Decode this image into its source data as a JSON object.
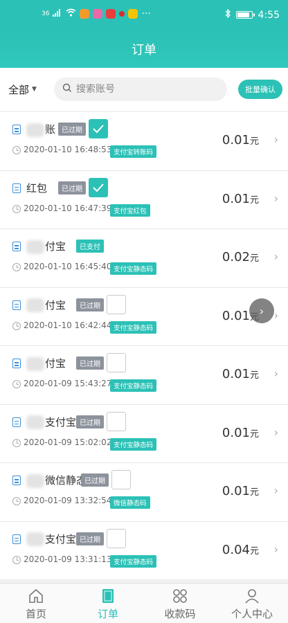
{
  "statusbar": {
    "signal": "36",
    "time": "4:55",
    "dots": "···"
  },
  "header": {
    "title": "订单"
  },
  "toolbar": {
    "filter": "全部",
    "search_placeholder": "搜索账号",
    "batch_confirm": "批量确认"
  },
  "orders": [
    {
      "name": "账",
      "status": "已过期",
      "status_type": "expired",
      "checked": true,
      "time": "2020-01-10 16:48:53",
      "channel": "支付宝转账码",
      "amount": "0.01",
      "unit": "元"
    },
    {
      "name": "红包",
      "status": "已过期",
      "status_type": "expired",
      "checked": true,
      "time": "2020-01-10 16:47:39",
      "channel": "支付宝红包",
      "amount": "0.01",
      "unit": "元"
    },
    {
      "name": "付宝",
      "status": "已支付",
      "status_type": "paid",
      "checked": null,
      "time": "2020-01-10 16:45:40",
      "channel": "支付宝静态码",
      "amount": "0.02",
      "unit": "元"
    },
    {
      "name": "付宝",
      "status": "已过期",
      "status_type": "expired",
      "checked": false,
      "time": "2020-01-10 16:42:44",
      "channel": "支付宝静态码",
      "amount": "0.01",
      "unit": "元"
    },
    {
      "name": "付宝",
      "status": "已过期",
      "status_type": "expired",
      "checked": false,
      "time": "2020-01-09 15:43:27",
      "channel": "支付宝静态码",
      "amount": "0.01",
      "unit": "元"
    },
    {
      "name": "支付宝",
      "status": "已过期",
      "status_type": "expired",
      "checked": false,
      "time": "2020-01-09 15:02:02",
      "channel": "支付宝静态码",
      "amount": "0.01",
      "unit": "元"
    },
    {
      "name": "微信静态",
      "status": "已过期",
      "status_type": "expired",
      "checked": false,
      "time": "2020-01-09 13:32:54",
      "channel": "微信静态码",
      "amount": "0.01",
      "unit": "元"
    },
    {
      "name": "支付宝",
      "status": "已过期",
      "status_type": "expired",
      "checked": false,
      "time": "2020-01-09 13:31:13",
      "channel": "支付宝静态码",
      "amount": "0.04",
      "unit": "元"
    }
  ],
  "tabs": [
    {
      "label": "首页",
      "icon": "home-icon",
      "active": false
    },
    {
      "label": "订单",
      "icon": "order-icon",
      "active": true
    },
    {
      "label": "收款码",
      "icon": "qrcode-icon",
      "active": false
    },
    {
      "label": "个人中心",
      "icon": "user-icon",
      "active": false
    }
  ],
  "colors": {
    "accent": "#2cc1b6",
    "expired": "#8d939c"
  }
}
